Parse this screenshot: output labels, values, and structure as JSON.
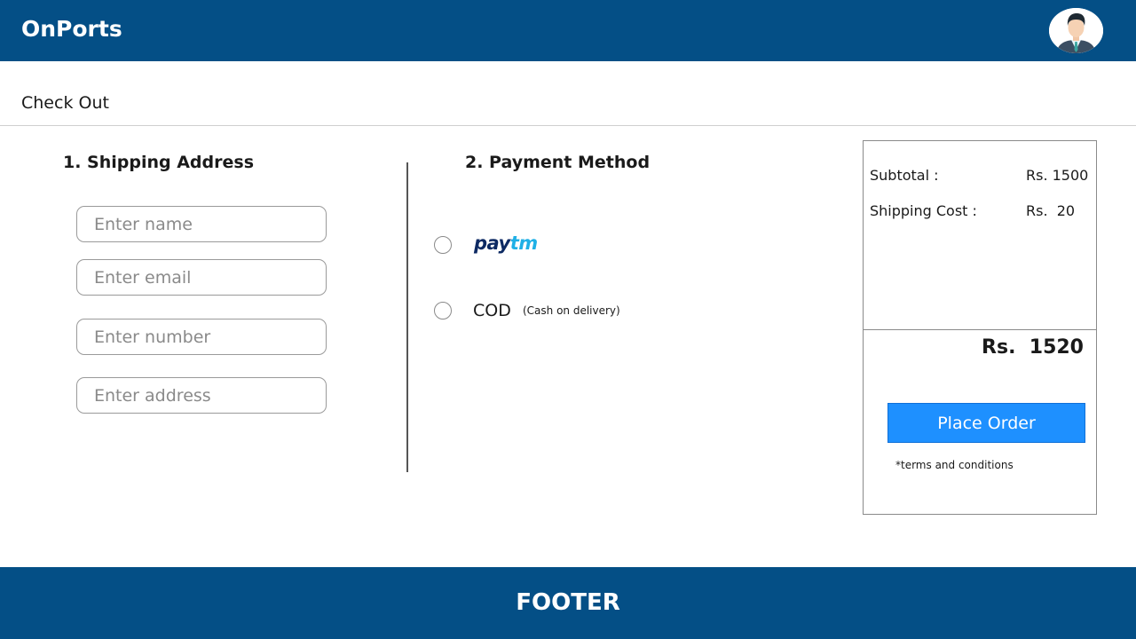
{
  "header": {
    "brand": "OnPorts",
    "avatar_icon": "user-avatar-icon"
  },
  "page": {
    "title": "Check Out"
  },
  "shipping": {
    "title": "1. Shipping Address",
    "fields": {
      "name_placeholder": "Enter name",
      "email_placeholder": "Enter email",
      "number_placeholder": "Enter number",
      "address_placeholder": "Enter address"
    }
  },
  "payment": {
    "title": "2. Payment Method",
    "options": {
      "paytm": {
        "logo_part1": "pay",
        "logo_part2": "tm",
        "selected": false
      },
      "cod": {
        "label": "COD",
        "note": "(Cash on delivery)",
        "selected": false
      }
    }
  },
  "summary": {
    "subtotal_label": "Subtotal :",
    "subtotal_value": "Rs. 1500",
    "shipping_label": "Shipping Cost :",
    "shipping_value": "Rs.  20",
    "total": "Rs.  1520",
    "place_order_label": "Place Order",
    "terms": "*terms and conditions"
  },
  "footer": {
    "text": "FOOTER"
  },
  "colors": {
    "header_bg": "#044f86",
    "button_bg": "#1e90ff",
    "paytm_dark": "#0d2a63",
    "paytm_light": "#1fb0e6"
  }
}
